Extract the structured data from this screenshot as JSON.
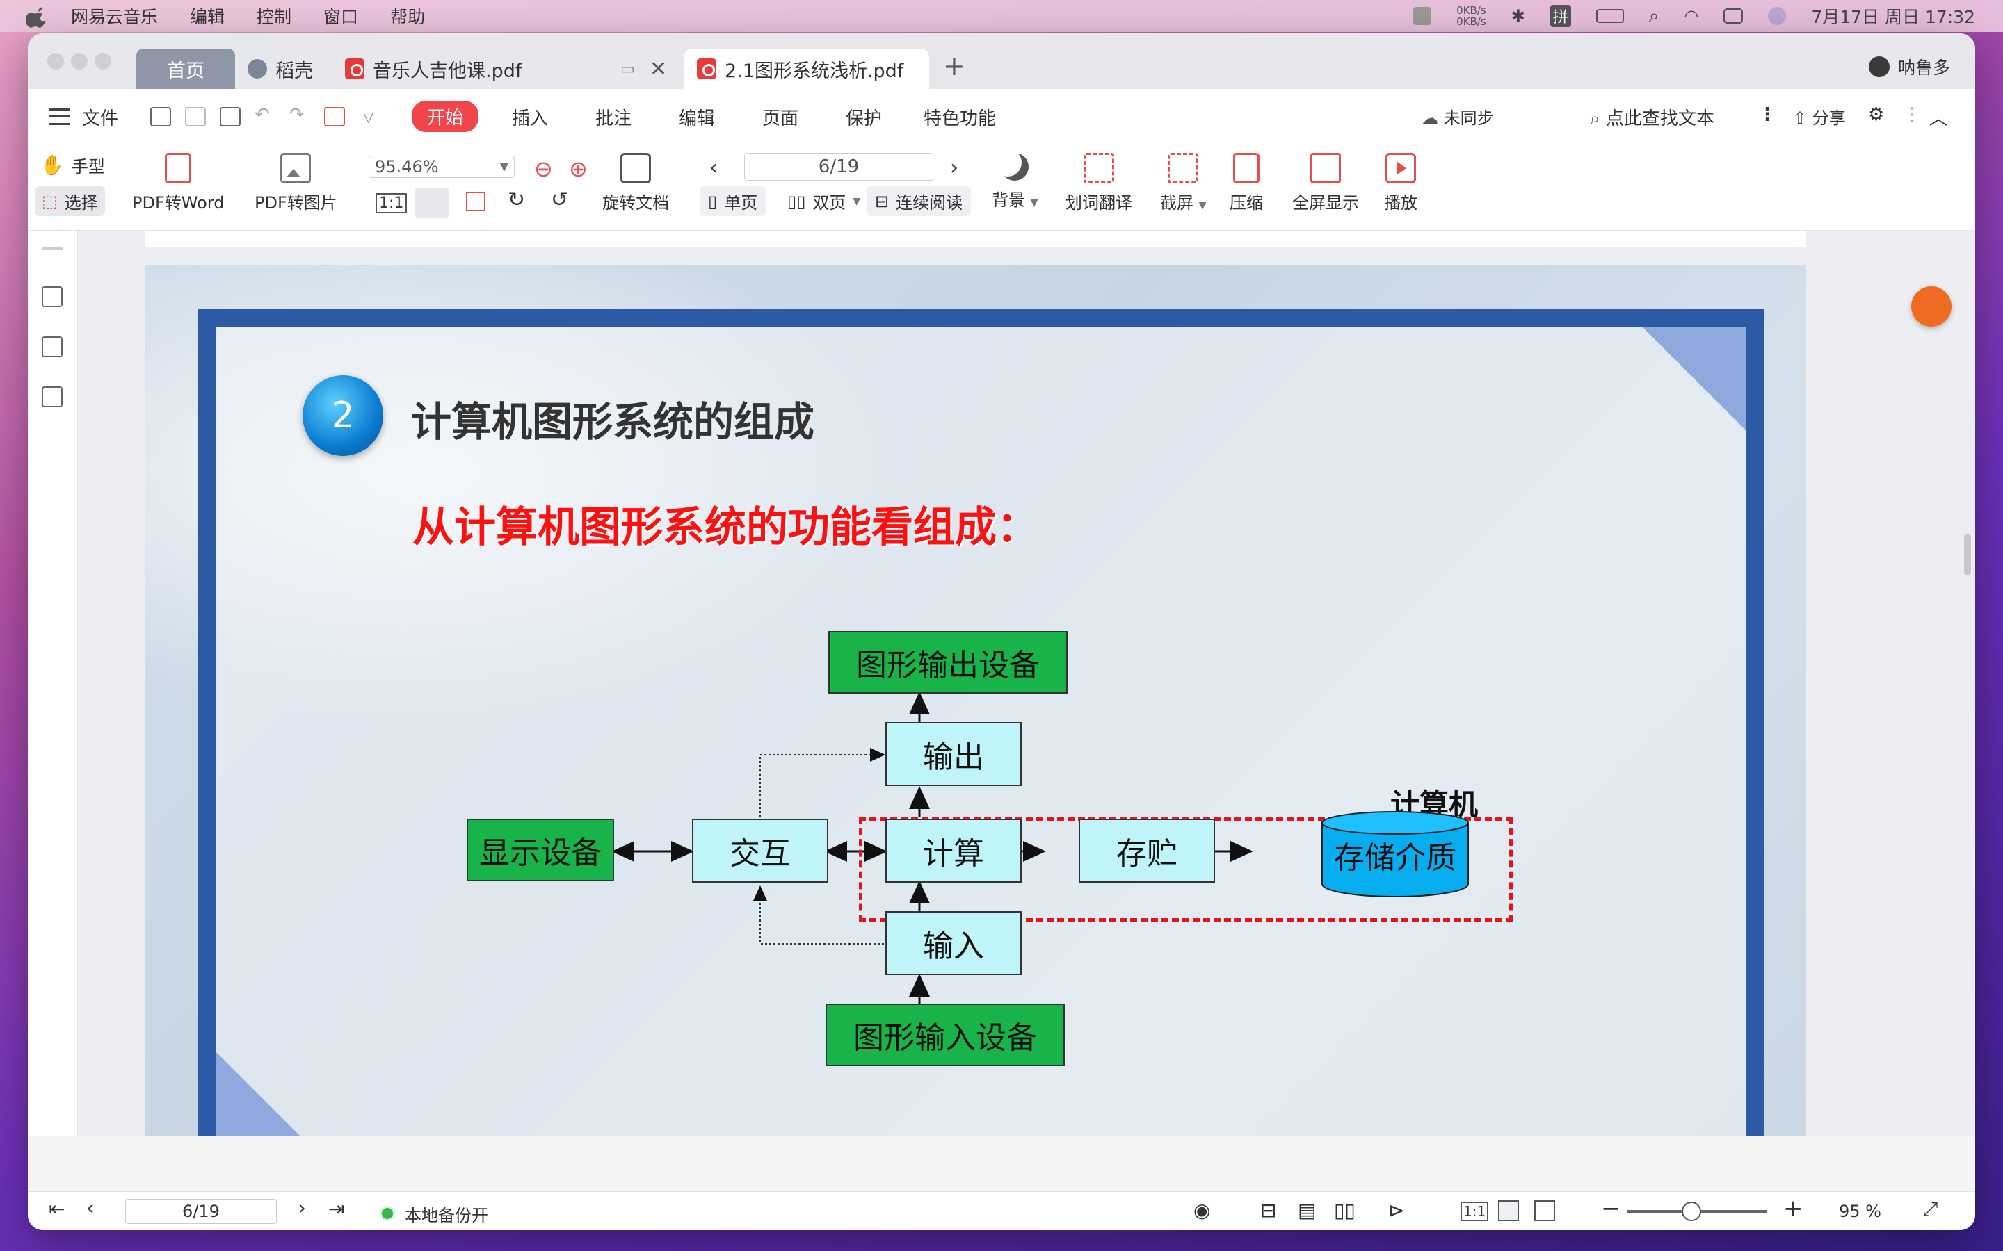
{
  "menubar": {
    "app": "网易云音乐",
    "items": [
      "编辑",
      "控制",
      "窗口",
      "帮助"
    ],
    "net_up": "0KB/s",
    "net_down": "0KB/s",
    "ime": "拼",
    "datetime": "7月17日 周日  17:32"
  },
  "tabs": {
    "home": "首页",
    "daoke": "稻壳",
    "tab1": "音乐人吉他课.pdf",
    "tab2": "2.1图形系统浅析.pdf",
    "user": "呐鲁多"
  },
  "menu": {
    "file": "文件",
    "start": "开始",
    "insert": "插入",
    "annotate": "批注",
    "edit": "编辑",
    "page": "页面",
    "protect": "保护",
    "special": "特色功能",
    "sync": "未同步",
    "find": "点此查找文本",
    "share": "分享"
  },
  "toolbar": {
    "hand": "手型",
    "select": "选择",
    "pdf_word": "PDF转Word",
    "pdf_img": "PDF转图片",
    "zoom": "95.46%",
    "rotate": "旋转文档",
    "page": "6/19",
    "single": "单页",
    "double": "双页",
    "continuous": "连续阅读",
    "background": "背景",
    "translate": "划词翻译",
    "screenshot": "截屏",
    "compress": "压缩",
    "fullscreen": "全屏显示",
    "play": "播放"
  },
  "slide": {
    "badge": "2",
    "heading": "计算机图形系统的组成",
    "subheading": "从计算机图形系统的功能看组成：",
    "computer_label": "计算机",
    "boxes": {
      "out_device": "图形输出设备",
      "output": "输出",
      "display": "显示设备",
      "interact": "交互",
      "compute": "计算",
      "store": "存贮",
      "medium": "存储介质",
      "input": "输入",
      "in_device": "图形输入设备"
    }
  },
  "status": {
    "page": "6/19",
    "backup": "本地备份开",
    "zoom": "95 %"
  },
  "colors": {
    "accent_red": "#f0454a",
    "frame_blue": "#2c5aa4",
    "box_green": "#18b44a",
    "box_cyan": "#bff4f8",
    "dash_red": "#e0161c"
  }
}
